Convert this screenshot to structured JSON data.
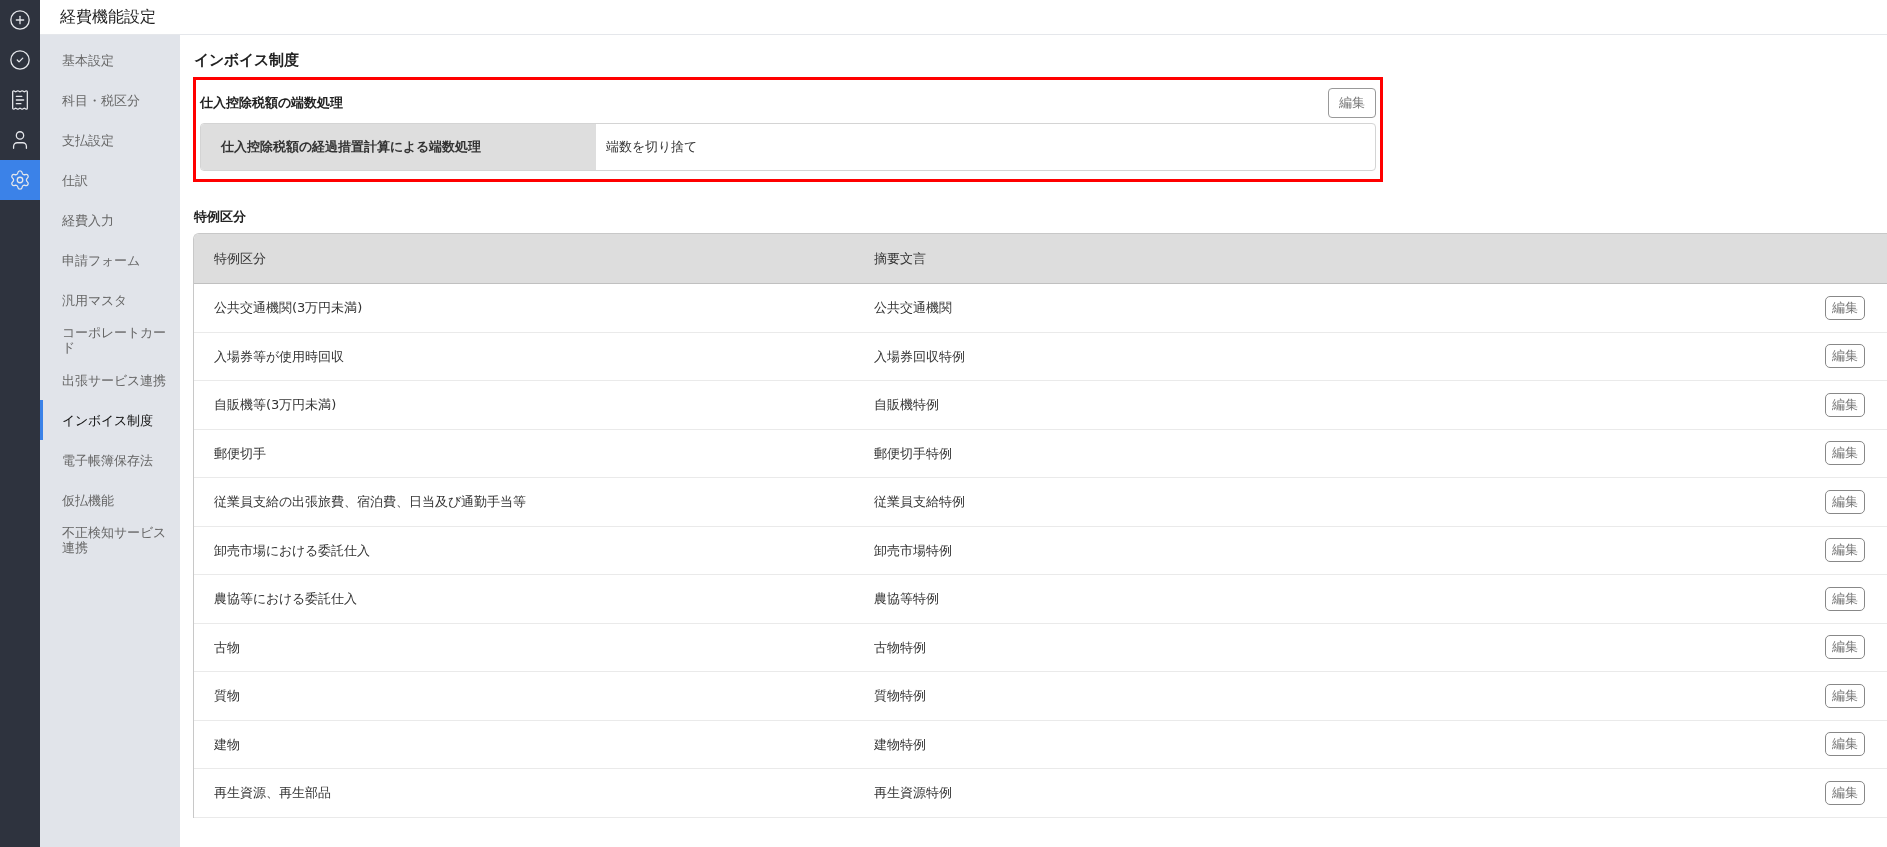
{
  "rail": [
    {
      "kind": "plus",
      "selected": false
    },
    {
      "kind": "check",
      "selected": false
    },
    {
      "kind": "receipt",
      "selected": false
    },
    {
      "kind": "user",
      "selected": false
    },
    {
      "kind": "gear",
      "selected": true
    }
  ],
  "header": {
    "title": "経費機能設定"
  },
  "sidebar": {
    "items": [
      {
        "label": "基本設定",
        "selected": false
      },
      {
        "label": "科目・税区分",
        "selected": false
      },
      {
        "label": "支払設定",
        "selected": false
      },
      {
        "label": "仕訳",
        "selected": false
      },
      {
        "label": "経費入力",
        "selected": false
      },
      {
        "label": "申請フォーム",
        "selected": false
      },
      {
        "label": "汎用マスタ",
        "selected": false
      },
      {
        "label": "コーポレートカード",
        "selected": false
      },
      {
        "label": "出張サービス連携",
        "selected": false
      },
      {
        "label": "インボイス制度",
        "selected": true
      },
      {
        "label": "電子帳簿保存法",
        "selected": false
      },
      {
        "label": "仮払機能",
        "selected": false
      },
      {
        "label": "不正検知サービス連携",
        "selected": false
      }
    ]
  },
  "page_title": "インボイス制度",
  "rounding_section": {
    "title": "仕入控除税額の端数処理",
    "highlighted": true,
    "edit_button": "編集",
    "field_label": "仕入控除税額の経過措置計算による端数処理",
    "field_value": "端数を切り捨て"
  },
  "special_section": {
    "title": "特例区分",
    "table": {
      "columns": [
        "特例区分",
        "摘要文言"
      ],
      "rows": [
        {
          "category": "公共交通機関(3万円未満)",
          "summary": "公共交通機関",
          "edit": "編集"
        },
        {
          "category": "入場券等が使用時回収",
          "summary": "入場券回収特例",
          "edit": "編集"
        },
        {
          "category": "自販機等(3万円未満)",
          "summary": "自販機特例",
          "edit": "編集"
        },
        {
          "category": "郵便切手",
          "summary": "郵便切手特例",
          "edit": "編集"
        },
        {
          "category": "従業員支給の出張旅費、宿泊費、日当及び通勤手当等",
          "summary": "従業員支給特例",
          "edit": "編集"
        },
        {
          "category": "卸売市場における委託仕入",
          "summary": "卸売市場特例",
          "edit": "編集"
        },
        {
          "category": "農協等における委託仕入",
          "summary": "農協等特例",
          "edit": "編集"
        },
        {
          "category": "古物",
          "summary": "古物特例",
          "edit": "編集"
        },
        {
          "category": "質物",
          "summary": "質物特例",
          "edit": "編集"
        },
        {
          "category": "建物",
          "summary": "建物特例",
          "edit": "編集"
        },
        {
          "category": "再生資源、再生部品",
          "summary": "再生資源特例",
          "edit": "編集"
        }
      ]
    }
  }
}
